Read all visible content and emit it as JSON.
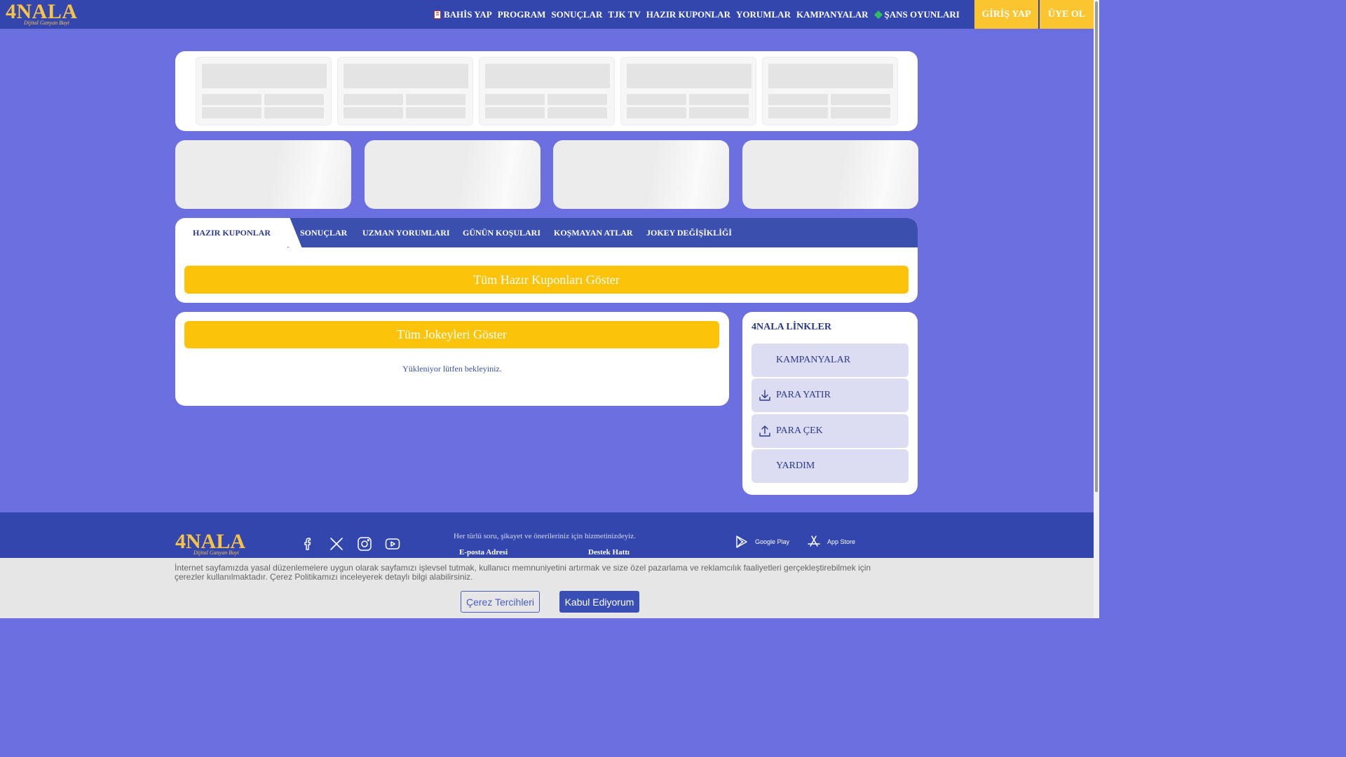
{
  "brand": {
    "logo_text": "4NALA",
    "logo_sub": "Dijital Ganyan Bayi",
    "color": "#f6c347"
  },
  "nav": {
    "items": [
      {
        "label": "BAHİS YAP",
        "icon": "bet-slip-icon"
      },
      {
        "label": "PROGRAM"
      },
      {
        "label": "SONUÇLAR"
      },
      {
        "label": "TJK TV"
      },
      {
        "label": "HAZIR KUPONLAR"
      },
      {
        "label": "YORUMLAR"
      },
      {
        "label": "KAMPANYALAR"
      },
      {
        "label": "ŞANS OYUNLARI",
        "icon": "clover-icon"
      }
    ],
    "login": "GİRİŞ YAP",
    "signup": "ÜYE OL"
  },
  "tabs": {
    "items": [
      "HAZIR KUPONLAR",
      "SONUÇLAR",
      "UZMAN YORUMLARI",
      "GÜNÜN KOŞULARI",
      "KOŞMAYAN ATLAR",
      "JOKEY DEĞİŞİKLİĞİ"
    ],
    "active": "HAZIR KUPONLAR",
    "show_all_button": "Tüm Hazır Kuponları Göster"
  },
  "jokey": {
    "show_all_button": "Tüm Jokeyleri Göster",
    "loading_text": "Yükleniyor lütfen bekleyiniz."
  },
  "links": {
    "title": "4NALA LİNKLER",
    "items": [
      {
        "label": "KAMPANYALAR",
        "icon": ""
      },
      {
        "label": "PARA YATIR",
        "icon": "download-icon"
      },
      {
        "label": "PARA ÇEK",
        "icon": "upload-icon"
      },
      {
        "label": "YARDIM",
        "icon": ""
      }
    ]
  },
  "footer": {
    "help_text": "Her türlü soru, şikayet ve önerileriniz için hizmetinizdeyiz.",
    "email_label": "E-posta Adresi",
    "support_label": "Destek Hattı",
    "social": [
      "facebook-icon",
      "x-icon",
      "instagram-icon",
      "youtube-icon"
    ],
    "google_play": "Google Play",
    "app_store": "App Store"
  },
  "cookie": {
    "text": "İnternet sayfamızda yasal düzenlemelere uygun olarak sayfamızı işlevsel tutmak, kullanıcı memnuniyetini artırmak ve size özel pazarlama ve reklamcılık faaliyetleri gerçekleştirebilmek için çerezler kullanılmaktadır. Çerez Politikamızı inceleyerek detaylı bilgi alabilirsiniz.",
    "preferences_button": "Çerez Tercihleri",
    "accept_button": "Kabul Ediyorum"
  },
  "colors": {
    "background": "#6b6fe0",
    "nav_bg": "#3246ae",
    "accent": "#fbc30a",
    "link_bg": "#dcdcf3"
  }
}
